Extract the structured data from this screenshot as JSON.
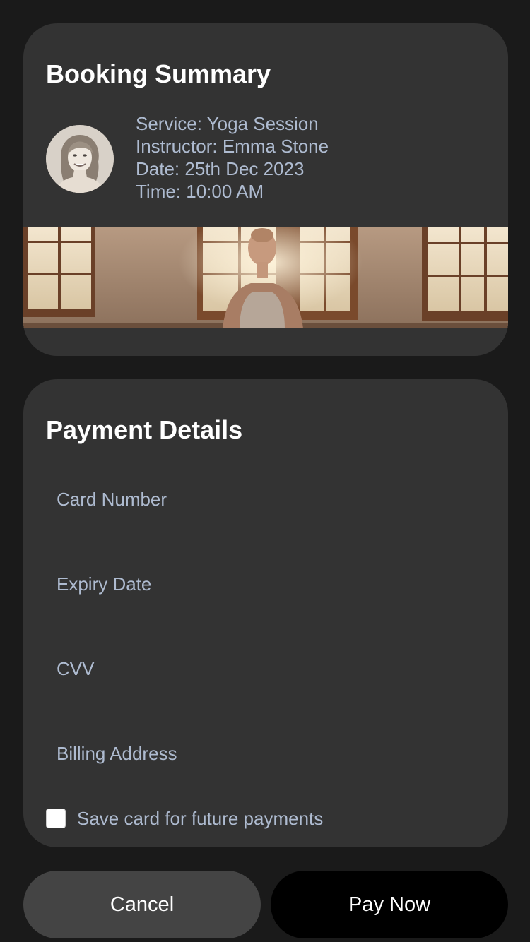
{
  "booking": {
    "title": "Booking Summary",
    "service": "Service: Yoga Session",
    "instructor": "Instructor: Emma Stone",
    "date": "Date: 25th Dec 2023",
    "time": "Time: 10:00 AM"
  },
  "payment": {
    "title": "Payment Details",
    "fields": {
      "card_number": "Card Number",
      "expiry_date": "Expiry Date",
      "cvv": "CVV",
      "billing_address": "Billing Address"
    },
    "save_card_label": "Save card for future payments",
    "save_card_checked": false
  },
  "actions": {
    "cancel_label": "Cancel",
    "pay_label": "Pay Now"
  },
  "colors": {
    "background": "#1a1a1a",
    "card": "#333333",
    "muted_text": "#aebbd0",
    "cancel_button": "#444444",
    "pay_button": "#000000"
  }
}
